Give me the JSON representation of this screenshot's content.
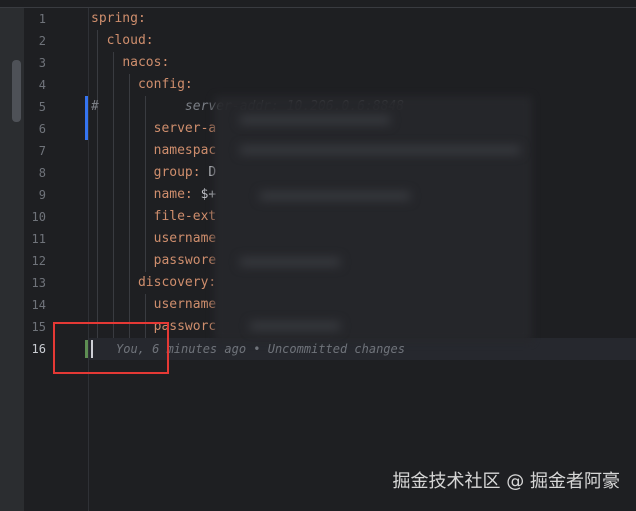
{
  "editor": {
    "current_line": 16,
    "lines": [
      {
        "num": "1",
        "indent": "",
        "key": "spring:",
        "val": ""
      },
      {
        "num": "2",
        "indent": "  ",
        "key": "cloud:",
        "val": ""
      },
      {
        "num": "3",
        "indent": "    ",
        "key": "nacos:",
        "val": ""
      },
      {
        "num": "4",
        "indent": "      ",
        "key": "config:",
        "val": ""
      },
      {
        "num": "5",
        "indent": "",
        "key": "",
        "val": "",
        "comment": "#           server-addr: 10.206.0.6:8848"
      },
      {
        "num": "6",
        "indent": "        ",
        "key": "server-a",
        "val": ""
      },
      {
        "num": "7",
        "indent": "        ",
        "key": "namespac",
        "val": ""
      },
      {
        "num": "8",
        "indent": "        ",
        "key": "group:",
        "val": " D"
      },
      {
        "num": "9",
        "indent": "        ",
        "key": "name:",
        "val": " $+"
      },
      {
        "num": "10",
        "indent": "        ",
        "key": "file-ext",
        "val": ""
      },
      {
        "num": "11",
        "indent": "        ",
        "key": "username",
        "val": ""
      },
      {
        "num": "12",
        "indent": "        ",
        "key": "passwore",
        "val": ""
      },
      {
        "num": "13",
        "indent": "      ",
        "key": "discovery:",
        "val": ""
      },
      {
        "num": "14",
        "indent": "        ",
        "key": "username",
        "val": ""
      },
      {
        "num": "15",
        "indent": "        ",
        "key": "passworc",
        "val": ""
      },
      {
        "num": "16",
        "indent": "",
        "key": "",
        "val": ""
      }
    ],
    "blame_inlay": "You, 6 minutes ago • Uncommitted changes"
  },
  "watermark": "掘金技术社区 @ 掘金者阿豪",
  "colors": {
    "background": "#1e1f22",
    "yaml_key": "#cf8e6d",
    "comment": "#7a7e85",
    "modified_marker": "#3574f0",
    "added_marker": "#5e8e53",
    "highlight_box": "#e53935"
  }
}
